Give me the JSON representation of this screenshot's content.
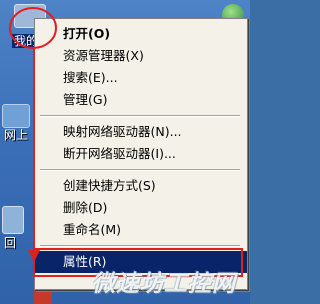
{
  "desktop": {
    "icon_labels": {
      "my_computer": "我的",
      "network": "网上",
      "back": "回"
    }
  },
  "context_menu": {
    "items": [
      {
        "label": "打开(O)",
        "bold": true
      },
      {
        "label": "资源管理器(X)"
      },
      {
        "label": "搜索(E)..."
      },
      {
        "label": "管理(G)"
      },
      {
        "label": "映射网络驱动器(N)..."
      },
      {
        "label": "断开网络驱动器(I)..."
      },
      {
        "label": "创建快捷方式(S)"
      },
      {
        "label": "删除(D)"
      },
      {
        "label": "重命名(M)"
      },
      {
        "label": "属性(R)",
        "highlighted": true
      }
    ]
  },
  "watermark": "微速坊工控网",
  "colors": {
    "highlight": "#0a246a",
    "annotation": "#e02020",
    "menu_bg": "#f3f1e8",
    "desktop_bg": "#3b6fb8"
  }
}
